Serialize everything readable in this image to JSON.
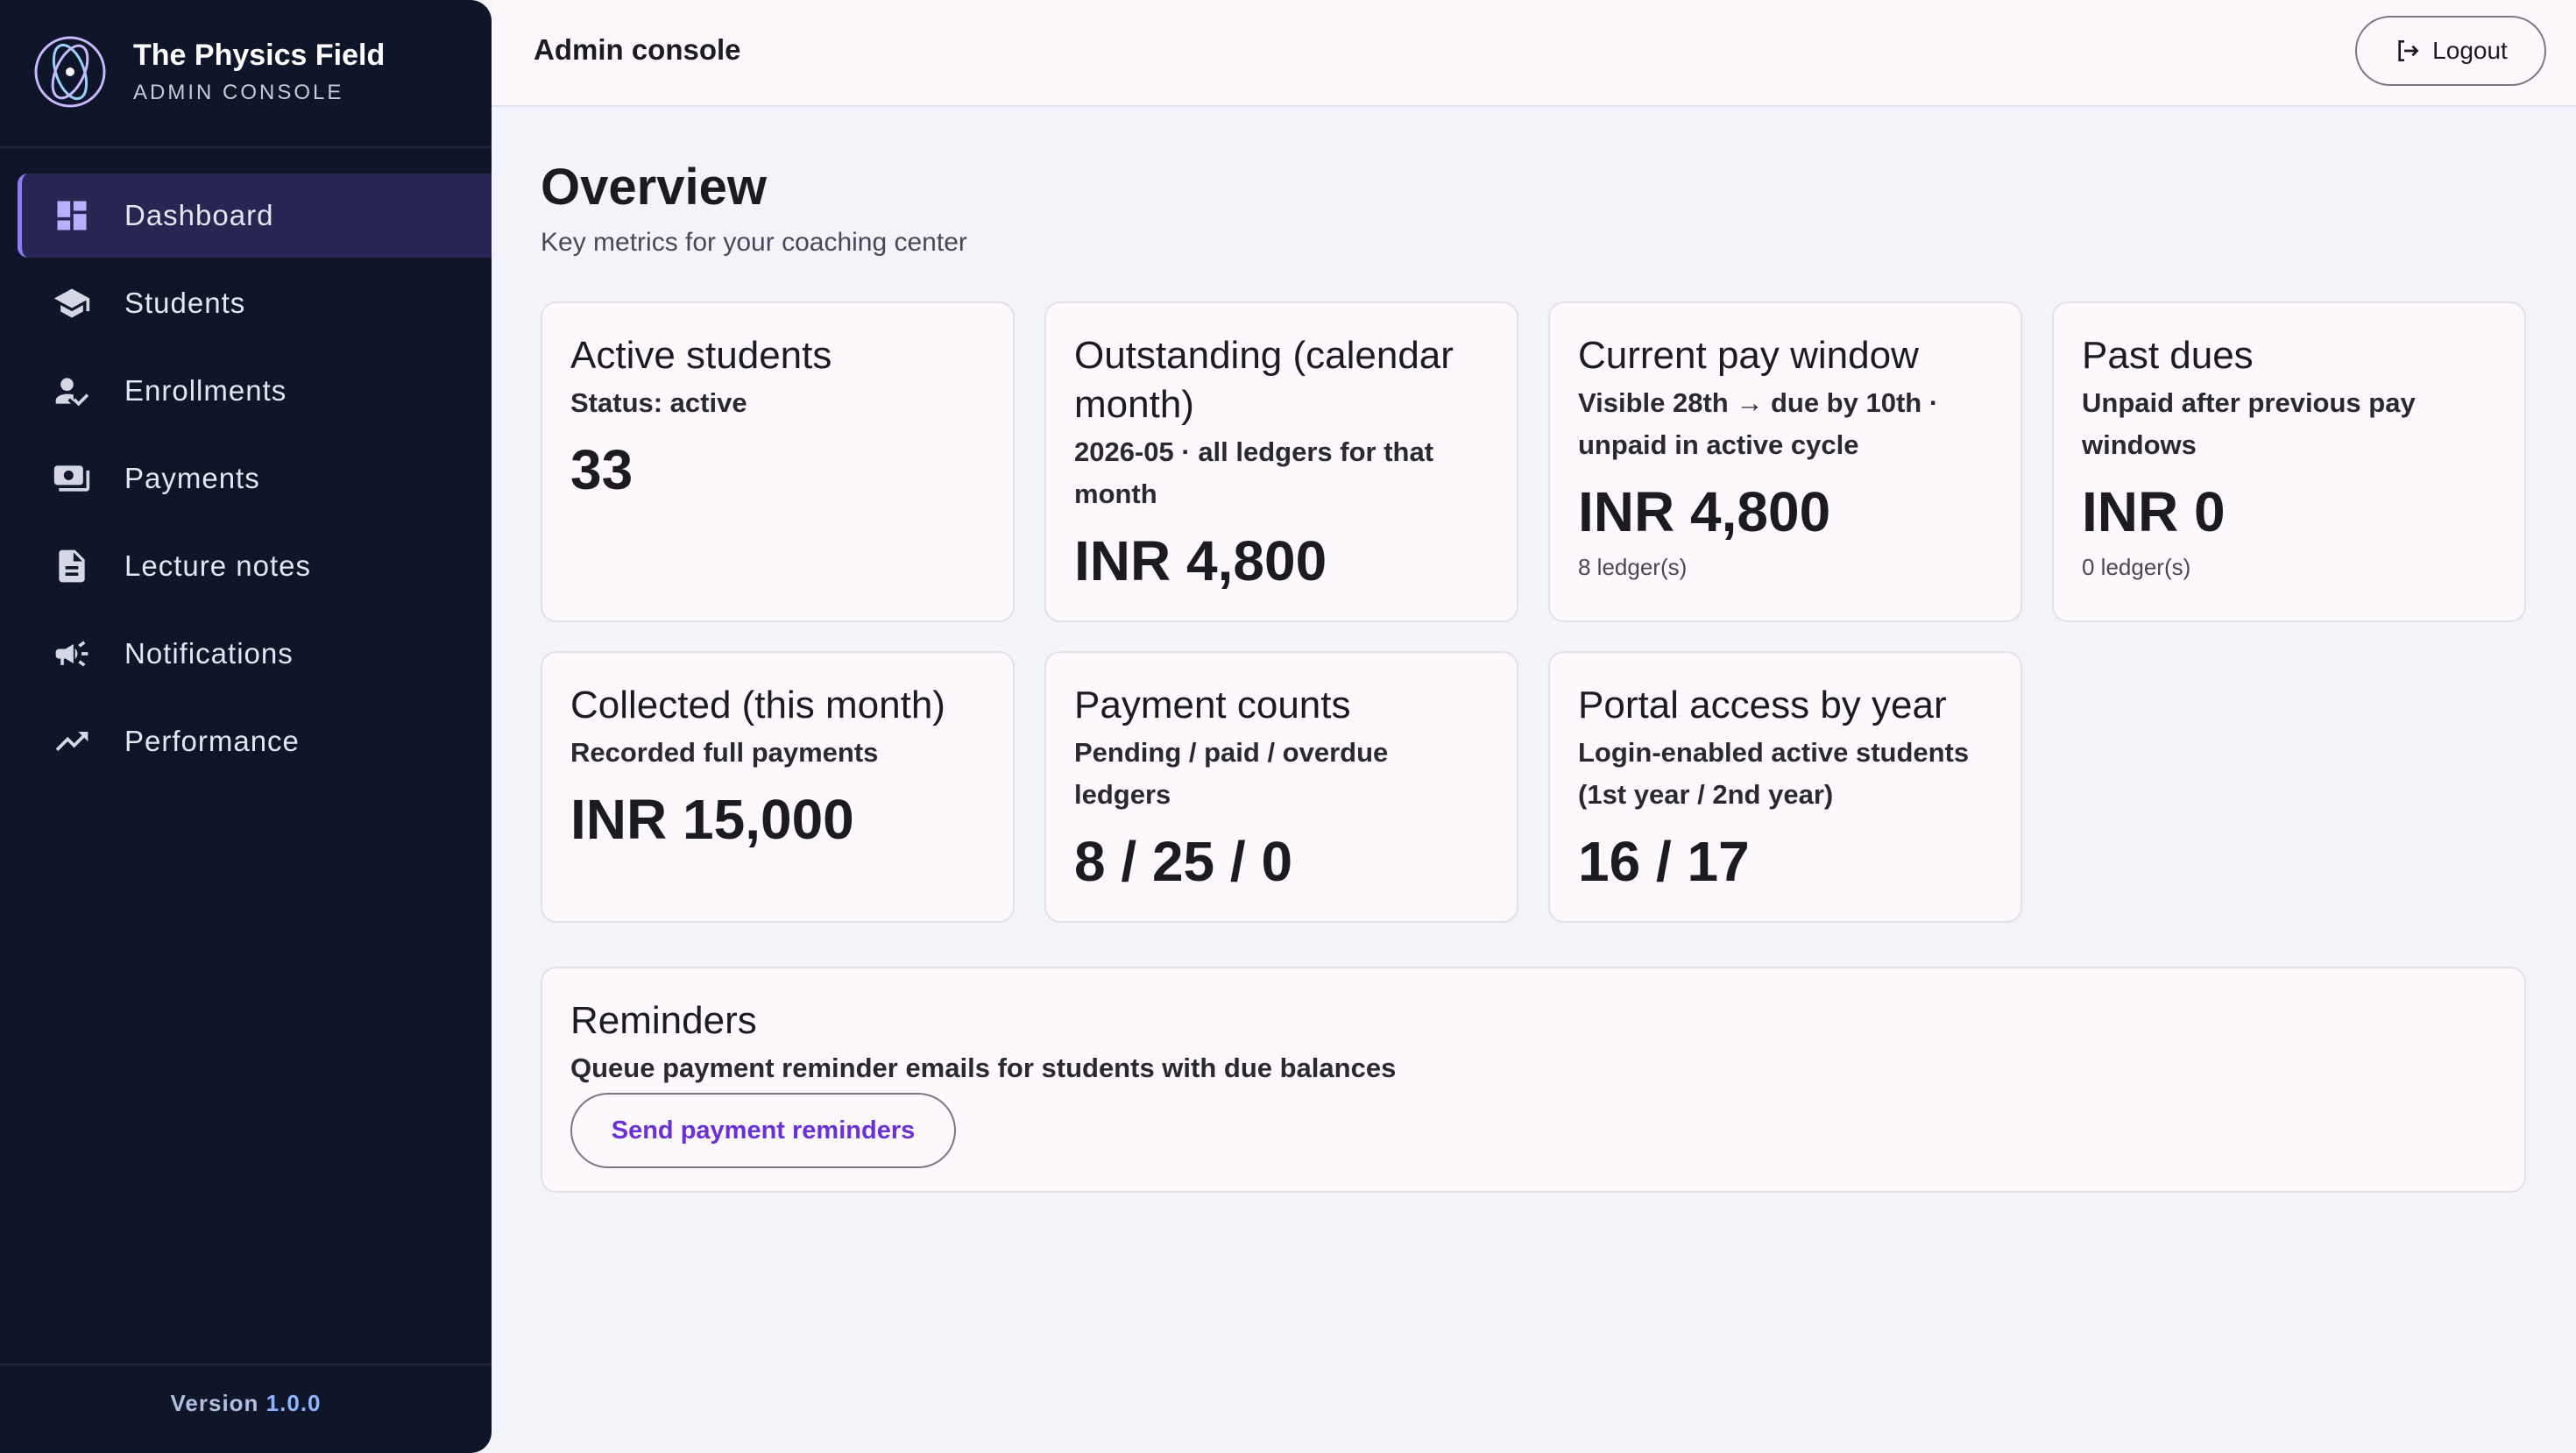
{
  "brand": {
    "title": "The Physics Field",
    "subtitle": "ADMIN CONSOLE",
    "logo_icon": "atom-icon"
  },
  "sidebar": {
    "items": [
      {
        "label": "Dashboard",
        "icon": "dashboard-icon",
        "active": true
      },
      {
        "label": "Students",
        "icon": "graduation-cap-icon",
        "active": false
      },
      {
        "label": "Enrollments",
        "icon": "person-check-icon",
        "active": false
      },
      {
        "label": "Payments",
        "icon": "cash-icon",
        "active": false
      },
      {
        "label": "Lecture notes",
        "icon": "document-icon",
        "active": false
      },
      {
        "label": "Notifications",
        "icon": "megaphone-icon",
        "active": false
      },
      {
        "label": "Performance",
        "icon": "trending-up-icon",
        "active": false
      }
    ],
    "version_label": "Version",
    "version_number": "1.0.0"
  },
  "topbar": {
    "title": "Admin console",
    "logout_label": "Logout"
  },
  "overview": {
    "title": "Overview",
    "subtitle": "Key metrics for your coaching center"
  },
  "cards": {
    "active_students": {
      "title": "Active students",
      "desc": "Status: active",
      "value": "33"
    },
    "outstanding": {
      "title": "Outstanding (calendar month)",
      "desc": "2026-05 · all ledgers for that month",
      "value": "INR 4,800"
    },
    "current_window": {
      "title": "Current pay window",
      "desc": "Visible 28th → due by 10th · unpaid in active cycle",
      "value": "INR 4,800",
      "foot": "8 ledger(s)"
    },
    "past_dues": {
      "title": "Past dues",
      "desc": "Unpaid after previous pay windows",
      "value": "INR 0",
      "foot": "0 ledger(s)"
    },
    "collected": {
      "title": "Collected (this month)",
      "desc": "Recorded full payments",
      "value": "INR 15,000"
    },
    "payment_counts": {
      "title": "Payment counts",
      "desc": "Pending / paid / overdue ledgers",
      "value": "8 / 25 / 0"
    },
    "portal_access": {
      "title": "Portal access by year",
      "desc": "Login-enabled active students (1st year / 2nd year)",
      "value": "16 / 17"
    }
  },
  "reminders": {
    "title": "Reminders",
    "desc": "Queue payment reminder emails for students with due balances",
    "button_label": "Send payment reminders"
  },
  "colors": {
    "sidebar_bg": "#0f1629",
    "active_item_bg": "#2a2654",
    "accent": "#8f7cf0",
    "button_text": "#6a2fd8"
  }
}
